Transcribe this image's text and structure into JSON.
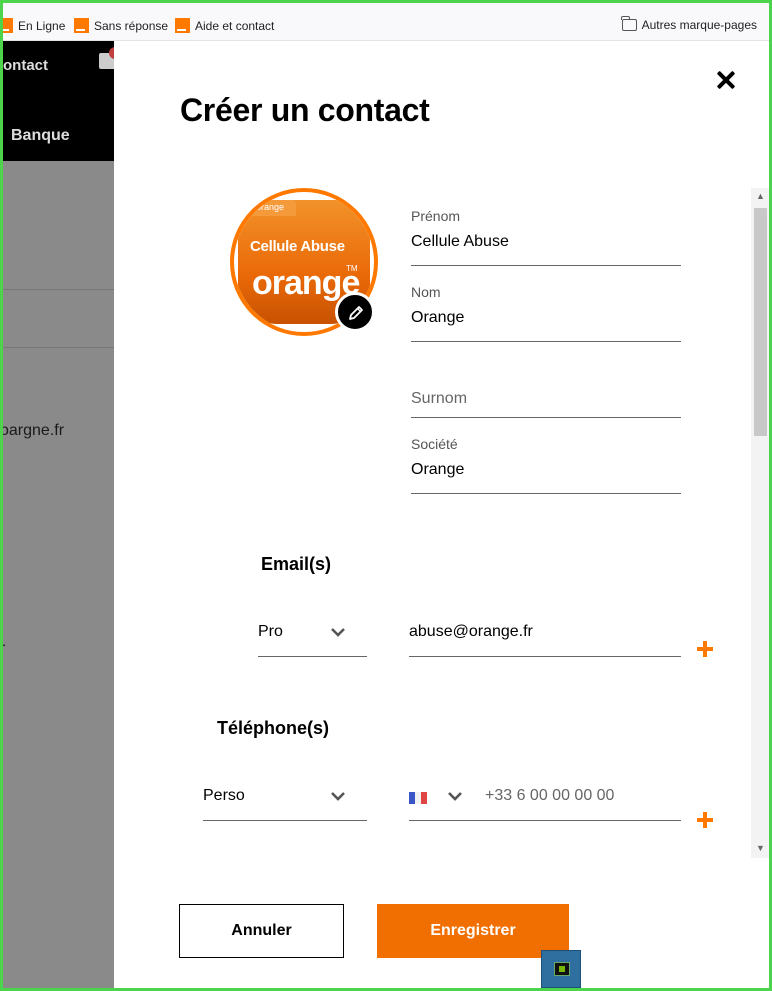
{
  "bookmarks": {
    "items": [
      {
        "label": "En Ligne"
      },
      {
        "label": "Sans réponse"
      },
      {
        "label": "Aide et contact"
      }
    ],
    "other": "Autres marque-pages"
  },
  "background_page": {
    "nav_contact": "ontact",
    "nav_banque": "Banque",
    "text_email": "oargne.fr",
    "text_fr": "r"
  },
  "modal": {
    "title": "Créer un contact",
    "avatar": {
      "tab_text": "orange",
      "label": "Cellule Abuse",
      "brand": "orange",
      "tm": "TM"
    },
    "fields": {
      "prenom": {
        "label": "Prénom",
        "value": "Cellule Abuse"
      },
      "nom": {
        "label": "Nom",
        "value": "Orange"
      },
      "surnom": {
        "placeholder": "Surnom"
      },
      "societe": {
        "label": "Société",
        "value": "Orange"
      }
    },
    "emails": {
      "title": "Email(s)",
      "type": "Pro",
      "value": "abuse@orange.fr"
    },
    "phones": {
      "title": "Téléphone(s)",
      "type": "Perso",
      "placeholder": "+33 6 00 00 00 00"
    },
    "buttons": {
      "cancel": "Annuler",
      "save": "Enregistrer"
    }
  },
  "colors": {
    "accent": "#ff7900",
    "save_button": "#f16e00",
    "window_border": "#4cd44c"
  }
}
